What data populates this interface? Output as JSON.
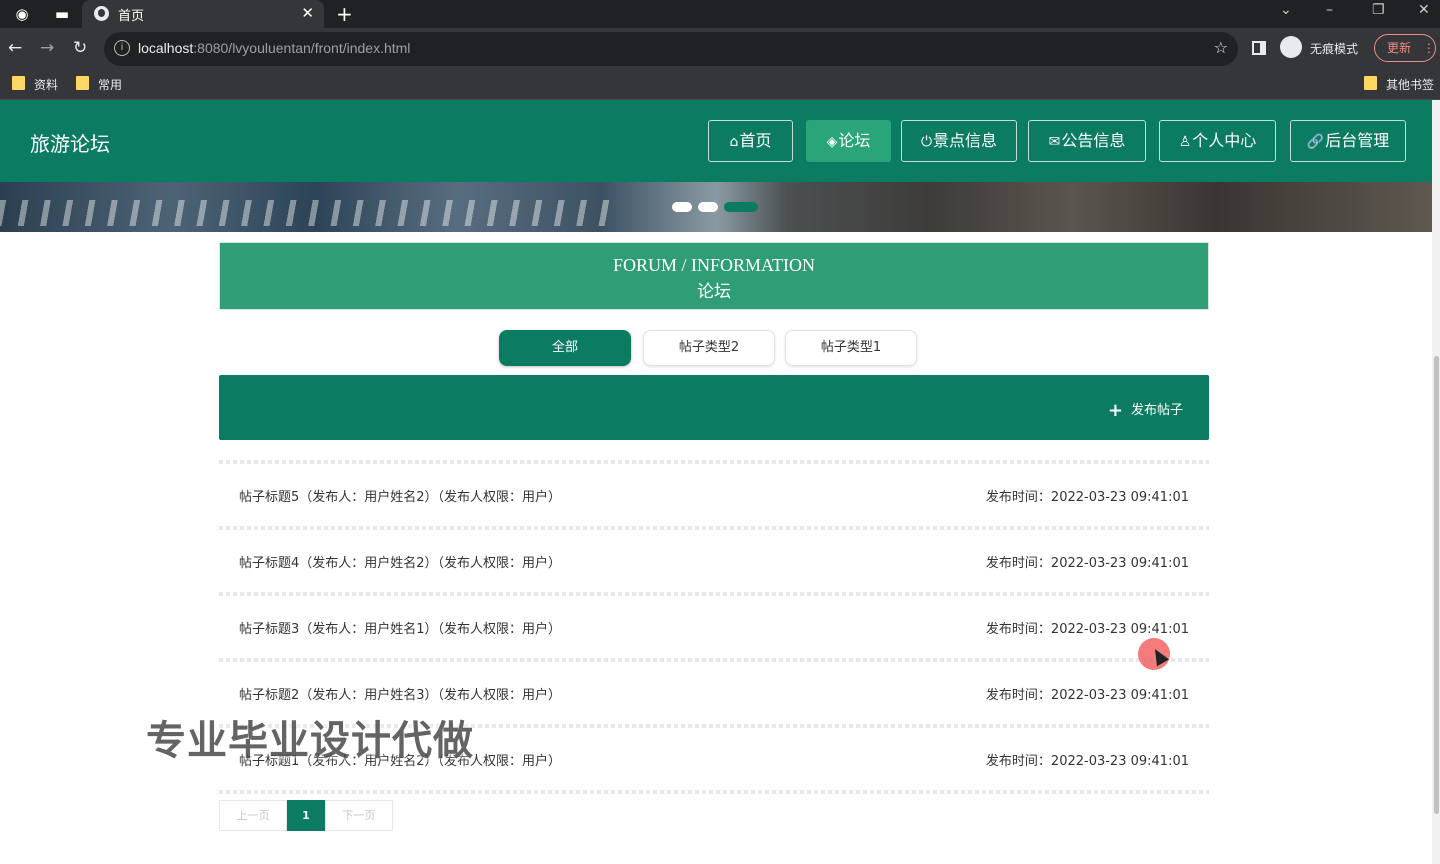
{
  "browser": {
    "tab_title": "首页",
    "url_host": "localhost",
    "url_rest": ":8080/lvyouluentan/front/index.html",
    "incognito_label": "无痕模式",
    "update_label": "更新",
    "bookmarks": [
      "资料",
      "常用"
    ],
    "other_bookmarks": "其他书签"
  },
  "header": {
    "logo": "旅游论坛",
    "nav": [
      {
        "icon": "⌂",
        "label": "首页"
      },
      {
        "icon": "◈",
        "label": "论坛"
      },
      {
        "icon": "⏻",
        "label": "景点信息"
      },
      {
        "icon": "✉",
        "label": "公告信息"
      },
      {
        "icon": "♙",
        "label": "个人中心"
      },
      {
        "icon": "🔗",
        "label": "后台管理"
      }
    ],
    "active_nav": "论坛"
  },
  "section": {
    "title_en": "FORUM / INFORMATION",
    "title_cn": "论坛"
  },
  "filters": [
    "全部",
    "帖子类型2",
    "帖子类型1"
  ],
  "active_filter": "全部",
  "post_button": "发布帖子",
  "posts": [
    {
      "title": "帖子标题5（发布人：用户姓名2）（发布人权限：用户）",
      "time": "发布时间：2022-03-23 09:41:01"
    },
    {
      "title": "帖子标题4（发布人：用户姓名2）（发布人权限：用户）",
      "time": "发布时间：2022-03-23 09:41:01"
    },
    {
      "title": "帖子标题3（发布人：用户姓名1）（发布人权限：用户）",
      "time": "发布时间：2022-03-23 09:41:01"
    },
    {
      "title": "帖子标题2（发布人：用户姓名3）（发布人权限：用户）",
      "time": "发布时间：2022-03-23 09:41:01"
    },
    {
      "title": "帖子标题1（发布人：用户姓名2）（发布人权限：用户）",
      "time": "发布时间：2022-03-23 09:41:01"
    }
  ],
  "pager": {
    "prev": "上一页",
    "current": "1",
    "next": "下一页"
  },
  "watermark": "专业毕业设计代做",
  "colors": {
    "primary": "#0b7b62",
    "accent": "#2f9e74",
    "active_nav": "#2aa57a"
  }
}
